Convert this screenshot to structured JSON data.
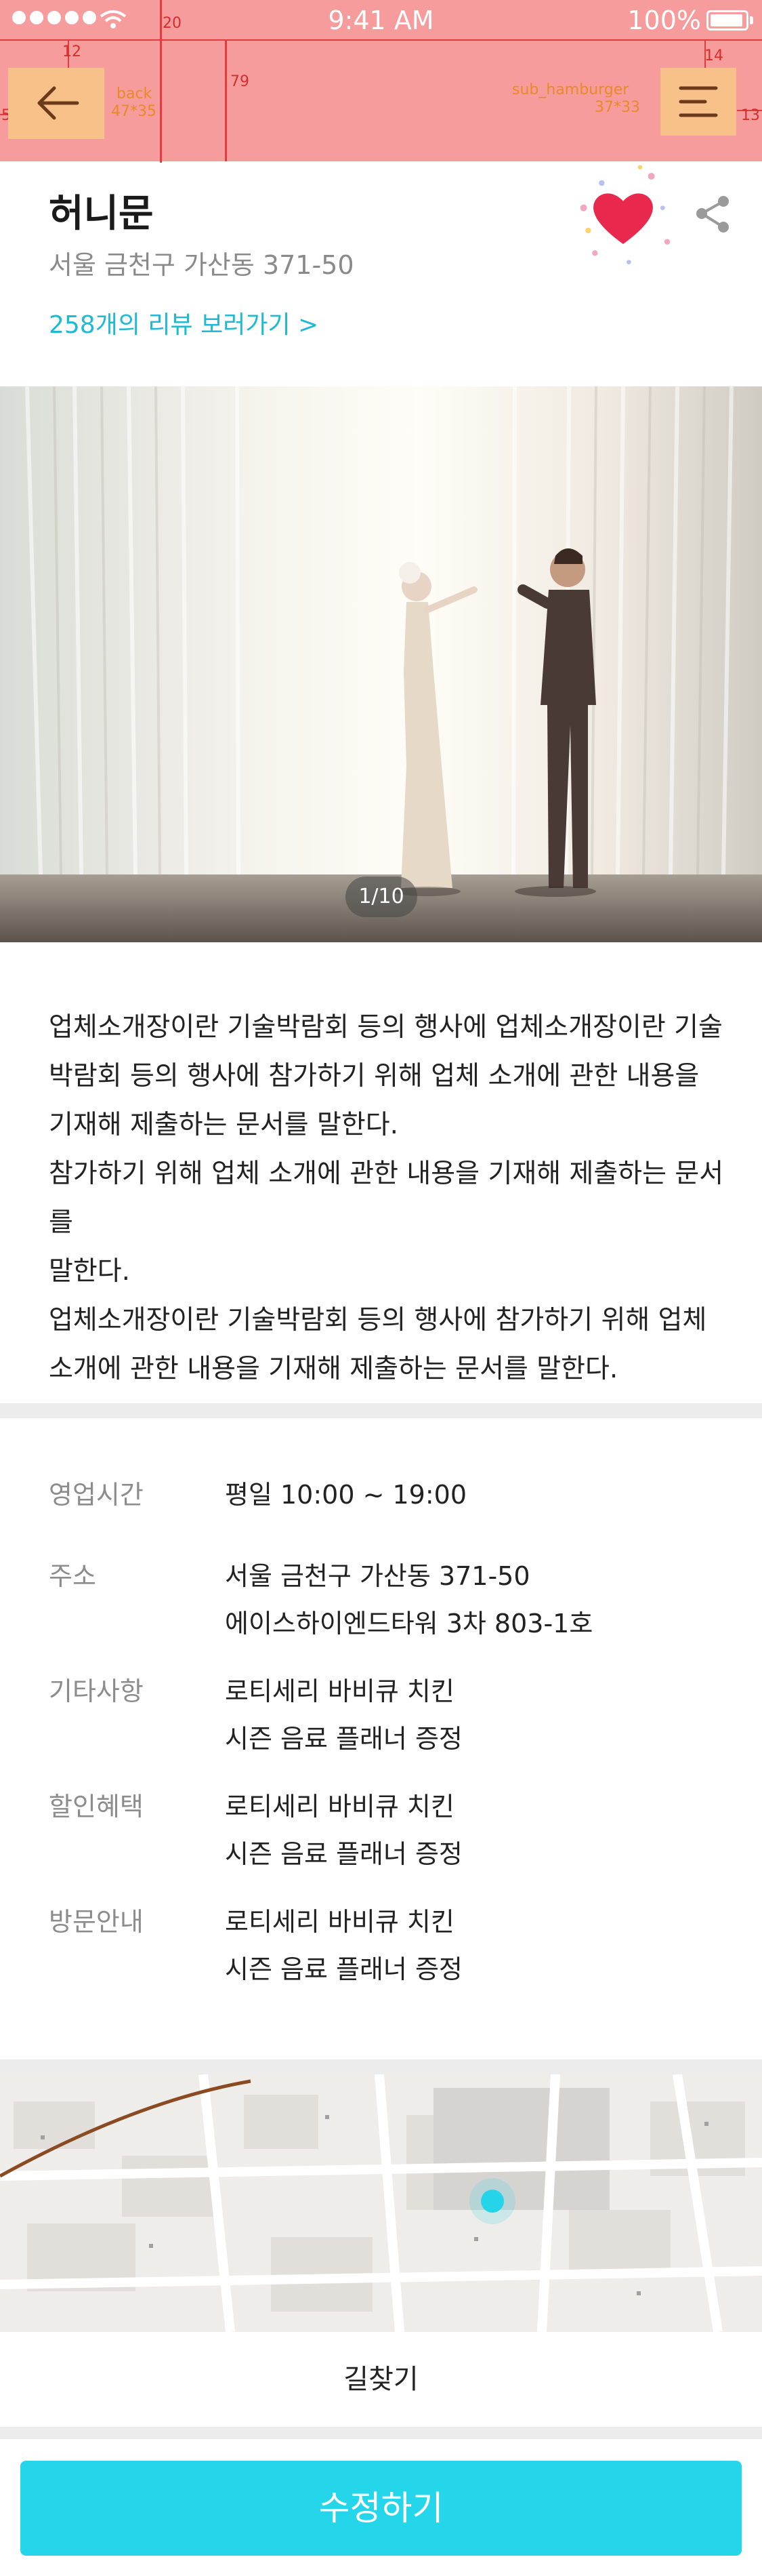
{
  "status_bar": {
    "time": "9:41 AM",
    "battery": "100%"
  },
  "redline": {
    "status_height": "20",
    "nav_height": "79",
    "back_margin_top": "12",
    "back_margin_left": "5",
    "menu_margin_top": "14",
    "menu_margin_right": "13",
    "back_label": "back",
    "back_size": "47*35",
    "menu_label": "sub_hamburger",
    "menu_size": "37*33"
  },
  "header": {
    "title": "허니문",
    "address": "서울 금천구 가산동 371-50",
    "review_link": "258개의 리뷰 보러가기 >"
  },
  "gallery": {
    "pager": "1/10"
  },
  "description": [
    "업체소개장이란 기술박람회 등의 행사에 업체소개장이란 기술",
    "박람회 등의 행사에 참가하기 위해 업체 소개에 관한 내용을",
    "기재해 제출하는 문서를 말한다.",
    "참가하기 위해 업체 소개에 관한 내용을 기재해 제출하는 문서를",
    "말한다.",
    "업체소개장이란 기술박람회 등의 행사에 참가하기 위해 업체",
    "소개에 관한 내용을 기재해 제출하는 문서를 말한다."
  ],
  "info": [
    {
      "label": "영업시간",
      "lines": [
        "평일 10:00 ~ 19:00"
      ]
    },
    {
      "label": "주소",
      "lines": [
        "서울 금천구 가산동 371-50",
        "에이스하이엔드타워 3차 803-1호"
      ]
    },
    {
      "label": "기타사항",
      "lines": [
        "로티세리 바비큐 치킨",
        "시즌 음료 플래너 증정"
      ]
    },
    {
      "label": "할인혜택",
      "lines": [
        "로티세리 바비큐 치킨",
        "시즌 음료 플래너 증정"
      ]
    },
    {
      "label": "방문안내",
      "lines": [
        "로티세리 바비큐 치킨",
        "시즌 음료 플래너 증정"
      ]
    }
  ],
  "map": {
    "route_label": "길찾기"
  },
  "footer": {
    "edit_button": "수정하기"
  },
  "colors": {
    "accent": "#25d5ea",
    "link": "#1fb9d3",
    "heart": "#e8284d",
    "redline": "#f79c9c"
  }
}
